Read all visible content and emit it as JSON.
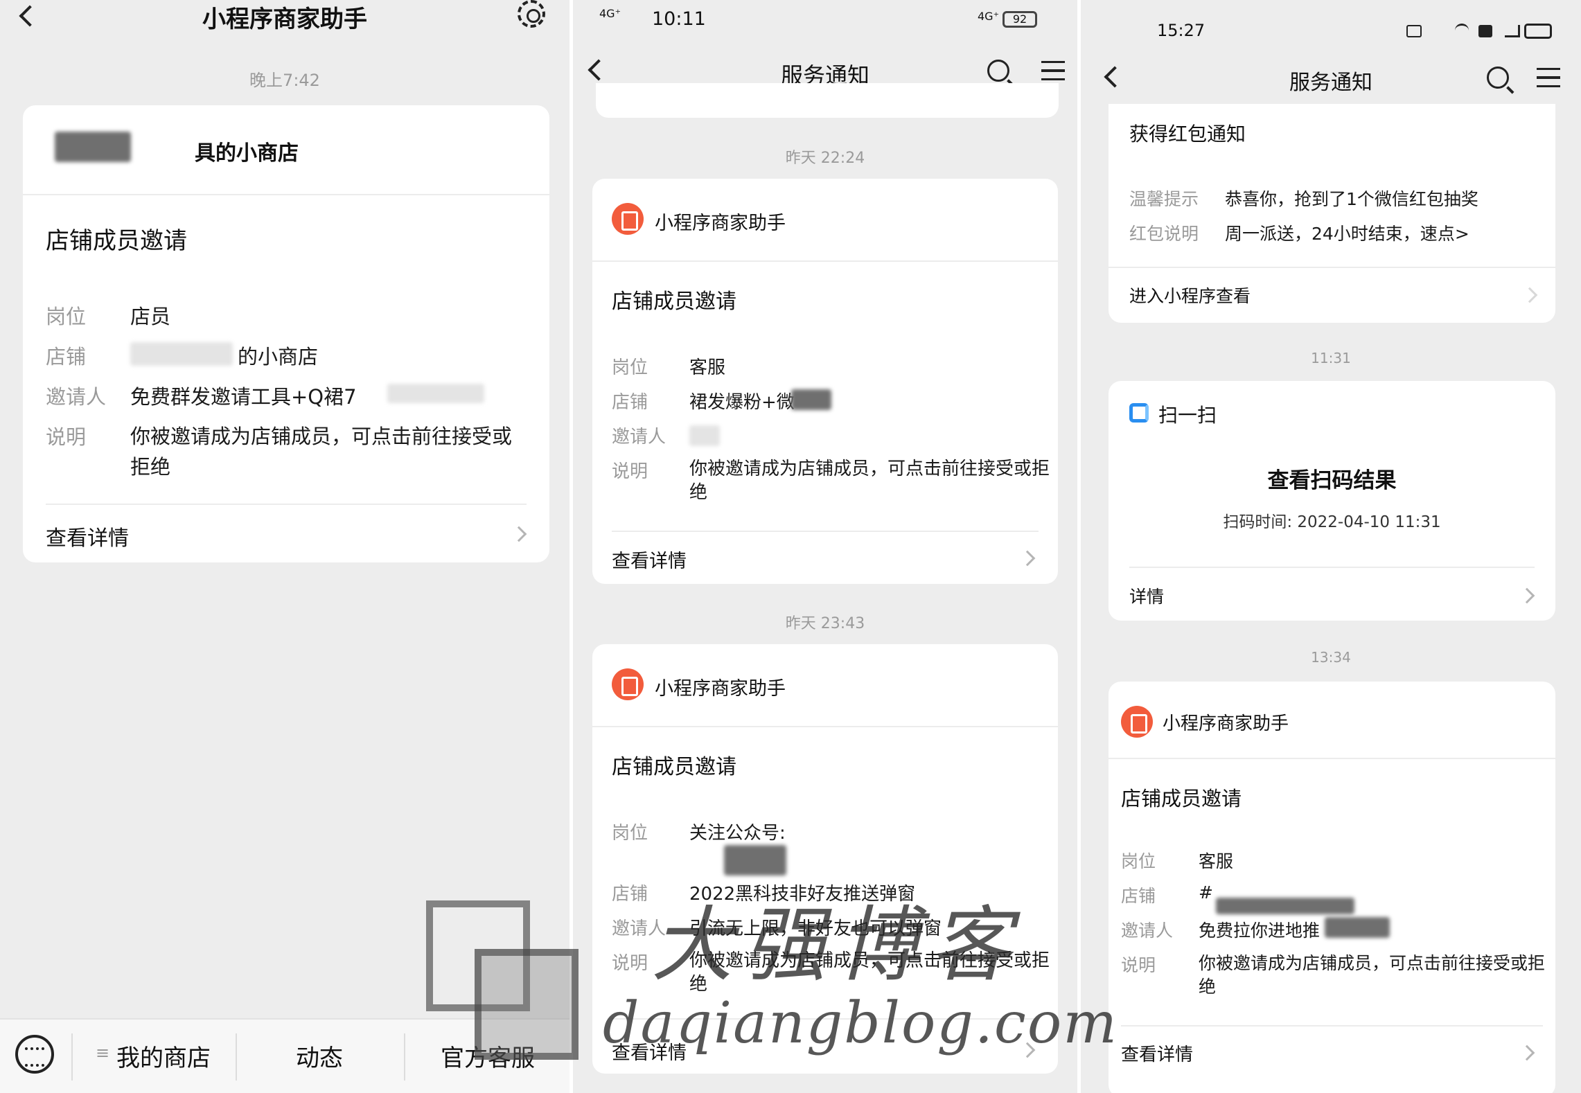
{
  "panel1": {
    "title": "小程序商家助手",
    "time": "晚上7:42",
    "shop_name": "具的小商店",
    "card_title": "店铺成员邀请",
    "rows": [
      {
        "label": "岗位",
        "value": "店员"
      },
      {
        "label": "店铺",
        "value": "的小商店"
      },
      {
        "label": "邀请人",
        "value": "免费群发邀请工具+Q裙7"
      },
      {
        "label": "说明",
        "value": "你被邀请成为店铺成员，可点击前往接受或拒绝"
      }
    ],
    "detail_link": "查看详情",
    "bottom_tabs": [
      {
        "label": "我的商店",
        "prefix": "≡"
      },
      {
        "label": "动态"
      },
      {
        "label": "官方客服"
      }
    ]
  },
  "panel2": {
    "status_left": "4G⁺",
    "status_time": "10:11",
    "status_right": "4G⁺",
    "battery": "92",
    "title": "服务通知",
    "time1": "昨天 22:24",
    "card1": {
      "brand": "小程序商家助手",
      "title": "店铺成员邀请",
      "rows": [
        {
          "label": "岗位",
          "value": "客服"
        },
        {
          "label": "店铺",
          "value": "裙发爆粉+微"
        },
        {
          "label": "邀请人",
          "value": ""
        },
        {
          "label": "说明",
          "value": "你被邀请成为店铺成员，可点击前往接受或拒绝"
        }
      ],
      "detail_link": "查看详情"
    },
    "time2": "昨天 23:43",
    "card2": {
      "brand": "小程序商家助手",
      "title": "店铺成员邀请",
      "rows": [
        {
          "label": "岗位",
          "value": "关注公众号:"
        },
        {
          "label": "店铺",
          "value": "2022黑科技非好友推送弹窗"
        },
        {
          "label": "邀请人",
          "value": "引流无上限，非好友也可以弹窗"
        },
        {
          "label": "说明",
          "value": "你被邀请成为店铺成员，可点击前往接受或拒绝"
        }
      ],
      "detail_link": "查看详情"
    }
  },
  "panel3": {
    "status_time": "15:27",
    "title": "服务通知",
    "hongbao": {
      "title": "获得红包通知",
      "rows": [
        {
          "label": "温馨提示",
          "value": "恭喜你，抢到了1个微信红包抽奖"
        },
        {
          "label": "红包说明",
          "value": "周一派送，24小时结束，速点>"
        }
      ],
      "link": "进入小程序查看"
    },
    "time1": "11:31",
    "scan": {
      "brand": "扫一扫",
      "title": "查看扫码结果",
      "subtitle": "扫码时间: 2022-04-10 11:31",
      "link": "详情"
    },
    "time2": "13:34",
    "card": {
      "brand": "小程序商家助手",
      "title": "店铺成员邀请",
      "rows": [
        {
          "label": "岗位",
          "value": "客服"
        },
        {
          "label": "店铺",
          "value": "#"
        },
        {
          "label": "邀请人",
          "value": "免费拉你进地推"
        },
        {
          "label": "说明",
          "value": "你被邀请成为店铺成员，可点击前往接受或拒绝"
        }
      ],
      "detail_link": "查看详情"
    }
  },
  "watermark": {
    "cn": "大强博客",
    "url": "daqiangblog.com"
  },
  "colors": {
    "background": "#ededed",
    "card": "#ffffff",
    "brand_icon": "#f25c3c",
    "scan_icon": "#2a8ef0"
  }
}
